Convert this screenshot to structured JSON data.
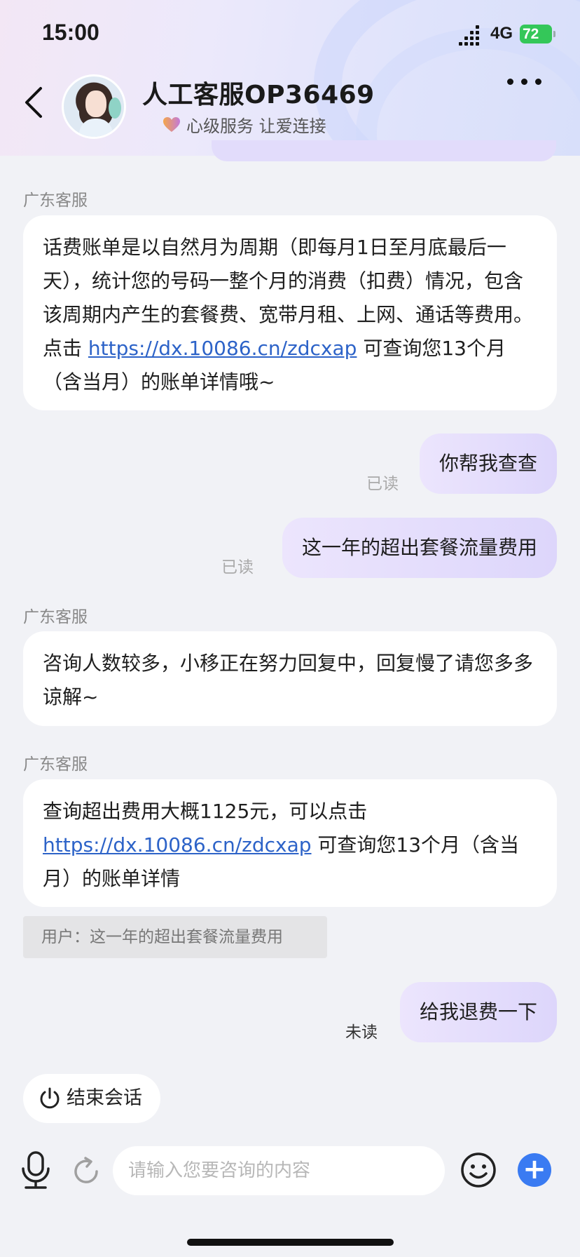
{
  "status_bar": {
    "time": "15:00",
    "network": "4G",
    "battery": "72"
  },
  "header": {
    "agent_name": "人工客服OP36469",
    "tagline": "心级服务 让爱连接"
  },
  "messages": {
    "m1": {
      "sender": "广东客服",
      "text_before": "话费账单是以自然月为周期（即每月1日至月底最后一天），统计您的号码一整个月的消费（扣费）情况，包含该周期内产生的套餐费、宽带月租、上网、通话等费用。点击 ",
      "link": "https://dx.10086.cn/zdcxap",
      "text_after": " 可查询您13个月（含当月）的账单详情哦~"
    },
    "m2": {
      "text": "你帮我查查",
      "status": "已读"
    },
    "m3": {
      "text": "这一年的超出套餐流量费用",
      "status": "已读"
    },
    "m4": {
      "sender": "广东客服",
      "text": "咨询人数较多，小移正在努力回复中，回复慢了请您多多谅解~"
    },
    "m5": {
      "sender": "广东客服",
      "text_before": "查询超出费用大概1125元，可以点击 ",
      "link": "https://dx.10086.cn/zdcxap",
      "text_after": " 可查询您13个月（含当月）的账单详情",
      "quote": "用户：这一年的超出套餐流量费用"
    },
    "m6": {
      "text": "给我退费一下",
      "status": "未读"
    }
  },
  "end_session_label": "结束会话",
  "input": {
    "placeholder": "请输入您要咨询的内容"
  }
}
